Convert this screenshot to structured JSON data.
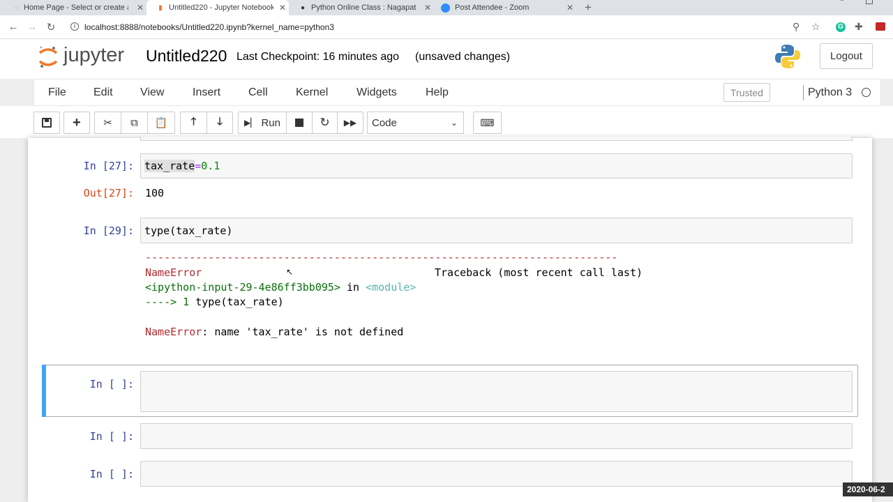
{
  "browser": {
    "tabs": [
      {
        "label": "Home Page - Select or create a n",
        "icon": "jupyter-favicon",
        "active": false
      },
      {
        "label": "Untitled220 - Jupyter Notebook",
        "icon": "notebook-favicon",
        "active": true
      },
      {
        "label": "Python Online Class : Nagapatta",
        "icon": "github-favicon",
        "active": false
      },
      {
        "label": "Post Attendee - Zoom",
        "icon": "zoom-favicon",
        "active": false
      }
    ],
    "new_tab": "+",
    "url": "localhost:8888/notebooks/Untitled220.ipynb?kernel_name=python3",
    "tab_close": "✕"
  },
  "header": {
    "logo_text": "jupyter",
    "notebook_name": "Untitled220",
    "checkpoint": "Last Checkpoint: 16 minutes ago",
    "unsaved": "(unsaved changes)",
    "logout": "Logout"
  },
  "menubar": {
    "items": [
      "File",
      "Edit",
      "View",
      "Insert",
      "Cell",
      "Kernel",
      "Widgets",
      "Help"
    ],
    "trusted": "Trusted",
    "kernel": "Python 3"
  },
  "toolbar": {
    "run_label": "Run",
    "cell_type": "Code"
  },
  "cells": {
    "c27": {
      "prompt": "In [27]:",
      "code_name": "tax_rate",
      "code_op": "=",
      "code_num": "0.1",
      "out_prompt": "Out[27]:",
      "output": "100"
    },
    "c29": {
      "prompt": "In [29]:",
      "code_func": "type(tax_rate)",
      "error_dashes": "---------------------------------------------------------------------------",
      "error_name": "NameError",
      "traceback_header": "Traceback (most recent call last)",
      "input_ref": "<ipython-input-29-4e86ff3bb095>",
      "input_in": " in ",
      "module_ref": "<module>",
      "arrow_line_arrow": "----> 1 ",
      "arrow_line_code": "type(tax_rate)",
      "error_msg_name": "NameError",
      "error_msg_rest": ": name 'tax_rate' is not defined"
    },
    "empty1": {
      "prompt": "In [ ]:"
    },
    "empty2": {
      "prompt": "In [ ]:"
    },
    "empty3": {
      "prompt": "In [ ]:"
    }
  },
  "watermark": "2020-06-2"
}
